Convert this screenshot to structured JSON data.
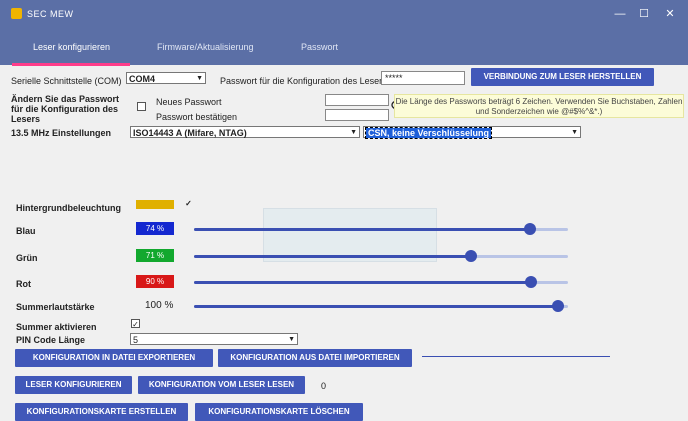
{
  "window": {
    "title": "SEC MEW"
  },
  "tabs": [
    {
      "label": "Leser konfigurieren",
      "active": true
    },
    {
      "label": "Firmware/Aktualisierung",
      "active": false
    },
    {
      "label": "Passwort",
      "active": false
    }
  ],
  "interface": {
    "label": "Serielle Schnittstelle (COM)",
    "value": "COM4",
    "password_label": "Passwort für die Konfiguration des Lesers",
    "password_value": "*****",
    "connect_button": "VERBINDUNG ZUM LESER HERSTELLEN"
  },
  "password_change": {
    "label": "Ändern Sie das Passwort für die Konfiguration des Lesers",
    "new_label": "Neues Passwort",
    "confirm_label": "Passwort bestätigen",
    "hint": "Die Länge des Passworts beträgt 6 Zeichen. Verwenden Sie Buchstaben, Zahlen und Sonderzeichen wie @#$%^&*.)"
  },
  "settings_13_5": {
    "label": "13.5 MHz Einstellungen",
    "protocol": "ISO14443 A (Mifare, NTAG)",
    "mode": "CSN, keine Verschlüsselung"
  },
  "backlight": {
    "label": "Hintergrundbeleuchtung",
    "color": "#e0b000",
    "checked": "✓"
  },
  "colors": [
    {
      "label": "Blau",
      "value_text": "74 %",
      "swatch": "#1428d0",
      "value": 0.74
    },
    {
      "label": "Grün",
      "value_text": "71 %",
      "swatch": "#12a82e",
      "value": 0.71
    },
    {
      "label": "Rot",
      "value_text": "90 %",
      "swatch": "#d81818",
      "value": 0.9
    }
  ],
  "buzzer": {
    "volume_label": "Summerlautstärke",
    "volume_text": "100 %",
    "volume": 1.0,
    "active_label": "Summer aktivieren",
    "active_checked": "✓"
  },
  "pin": {
    "label": "PIN Code Länge",
    "value": "5"
  },
  "buttons": {
    "export": "KONFIGURATION IN DATEI EXPORTIEREN",
    "import": "KONFIGURATION AUS DATEI IMPORTIEREN",
    "configure": "LESER KONFIGURIEREN",
    "read": "KONFIGURATION VOM LESER LESEN",
    "read_status": "0",
    "create_card": "KONFIGURATIONSKARTE ERSTELLEN",
    "delete_card": "KONFIGURATIONSKARTE LÖSCHEN"
  },
  "window_controls": {
    "minimize": "—",
    "maximize": "☐",
    "close": "✕"
  }
}
